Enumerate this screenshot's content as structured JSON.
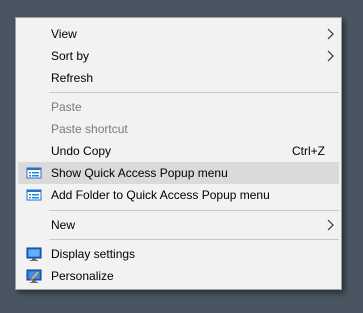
{
  "context_menu": {
    "items": [
      {
        "label": "View",
        "shortcut": "",
        "submenu": true,
        "disabled": false,
        "icon": ""
      },
      {
        "label": "Sort by",
        "shortcut": "",
        "submenu": true,
        "disabled": false,
        "icon": ""
      },
      {
        "label": "Refresh",
        "shortcut": "",
        "submenu": false,
        "disabled": false,
        "icon": ""
      },
      {
        "label": "Paste",
        "shortcut": "",
        "submenu": false,
        "disabled": true,
        "icon": ""
      },
      {
        "label": "Paste shortcut",
        "shortcut": "",
        "submenu": false,
        "disabled": true,
        "icon": ""
      },
      {
        "label": "Undo Copy",
        "shortcut": "Ctrl+Z",
        "submenu": false,
        "disabled": false,
        "icon": ""
      },
      {
        "label": "Show Quick Access Popup menu",
        "shortcut": "",
        "submenu": false,
        "disabled": false,
        "icon": "quick-access-popup-icon",
        "highlighted": true
      },
      {
        "label": "Add Folder to Quick Access Popup menu",
        "shortcut": "",
        "submenu": false,
        "disabled": false,
        "icon": "quick-access-popup-icon"
      },
      {
        "label": "New",
        "shortcut": "",
        "submenu": true,
        "disabled": false,
        "icon": ""
      },
      {
        "label": "Display settings",
        "shortcut": "",
        "submenu": false,
        "disabled": false,
        "icon": "display-settings-icon"
      },
      {
        "label": "Personalize",
        "shortcut": "",
        "submenu": false,
        "disabled": false,
        "icon": "personalize-icon"
      }
    ]
  },
  "colors": {
    "desktop_background": "#4a5562",
    "menu_background": "#f2f2f2",
    "highlight": "#dadada",
    "disabled_text": "#7a7a7a"
  }
}
